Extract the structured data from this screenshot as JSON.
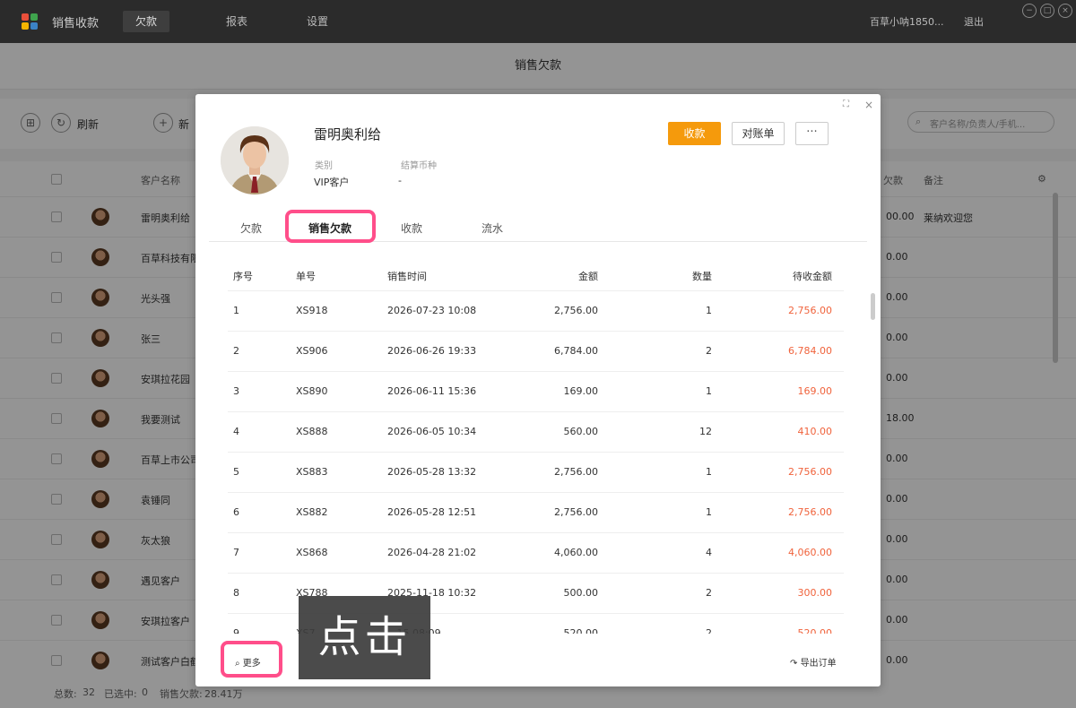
{
  "app": {
    "title": "销售收款",
    "nav": [
      "欠款",
      "报表",
      "设置"
    ],
    "nav_active_index": 0,
    "user": "百草小呐1850...",
    "logout": "退出"
  },
  "background_page": {
    "title": "销售欠款",
    "toolbar": {
      "refresh": "刷新",
      "add": "新"
    },
    "search_placeholder": "客户名称/负责人/手机...",
    "columns": {
      "name": "客户名称",
      "debt": "欠款",
      "remark": "备注"
    },
    "rows": [
      {
        "name": "雷明奥利给",
        "amount": "00.00",
        "remark": "莱纳欢迎您"
      },
      {
        "name": "百草科技有限",
        "amount": "0.00",
        "remark": ""
      },
      {
        "name": "光头强",
        "amount": "0.00",
        "remark": ""
      },
      {
        "name": "张三",
        "amount": "0.00",
        "remark": ""
      },
      {
        "name": "安琪拉花园",
        "amount": "0.00",
        "remark": ""
      },
      {
        "name": "我要测试",
        "amount": "18.00",
        "remark": ""
      },
      {
        "name": "百草上市公司",
        "amount": "0.00",
        "remark": ""
      },
      {
        "name": "袁锤同",
        "amount": "0.00",
        "remark": ""
      },
      {
        "name": "灰太狼",
        "amount": "0.00",
        "remark": ""
      },
      {
        "name": "遇见客户",
        "amount": "0.00",
        "remark": ""
      },
      {
        "name": "安琪拉客户",
        "amount": "0.00",
        "remark": ""
      },
      {
        "name": "测试客户白鹤",
        "amount": "0.00",
        "remark": ""
      }
    ],
    "footer": {
      "total_label": "总数:",
      "total": "32",
      "selected_label": "已选中:",
      "selected": "0",
      "debt_label": "销售欠款:",
      "debt": "28.41万"
    }
  },
  "modal": {
    "customer_name": "雷明奥利给",
    "category_label": "类别",
    "category_value": "VIP客户",
    "currency_label": "结算币种",
    "currency_value": "-",
    "buttons": {
      "collect": "收款",
      "statement": "对账单",
      "more": "···"
    },
    "tabs": [
      "欠款",
      "销售欠款",
      "收款",
      "流水"
    ],
    "active_tab_index": 1,
    "table": {
      "columns": [
        "序号",
        "单号",
        "销售时间",
        "金额",
        "数量",
        "待收金额"
      ],
      "rows": [
        {
          "no": "1",
          "order": "XS918",
          "time": "2026-07-23 10:08",
          "amount": "2,756.00",
          "qty": "1",
          "due": "2,756.00"
        },
        {
          "no": "2",
          "order": "XS906",
          "time": "2026-06-26 19:33",
          "amount": "6,784.00",
          "qty": "2",
          "due": "6,784.00"
        },
        {
          "no": "3",
          "order": "XS890",
          "time": "2026-06-11 15:36",
          "amount": "169.00",
          "qty": "1",
          "due": "169.00"
        },
        {
          "no": "4",
          "order": "XS888",
          "time": "2026-06-05 10:34",
          "amount": "560.00",
          "qty": "12",
          "due": "410.00"
        },
        {
          "no": "5",
          "order": "XS883",
          "time": "2026-05-28 13:32",
          "amount": "2,756.00",
          "qty": "1",
          "due": "2,756.00"
        },
        {
          "no": "6",
          "order": "XS882",
          "time": "2026-05-28 12:51",
          "amount": "2,756.00",
          "qty": "1",
          "due": "2,756.00"
        },
        {
          "no": "7",
          "order": "XS868",
          "time": "2026-04-28 21:02",
          "amount": "4,060.00",
          "qty": "4",
          "due": "4,060.00"
        },
        {
          "no": "8",
          "order": "XS788",
          "time": "2025-11-18 10:32",
          "amount": "500.00",
          "qty": "2",
          "due": "300.00"
        },
        {
          "no": "9",
          "order": "XS7..",
          "time": "...15 08:09",
          "amount": "520.00",
          "qty": "2",
          "due": "520.00"
        }
      ]
    },
    "more_label": "更多",
    "export_label": "导出订单"
  },
  "click_hint": "点击",
  "colors": {
    "accent": "#f59a0c",
    "highlight": "#ff4e8a",
    "due": "#f0633c"
  }
}
